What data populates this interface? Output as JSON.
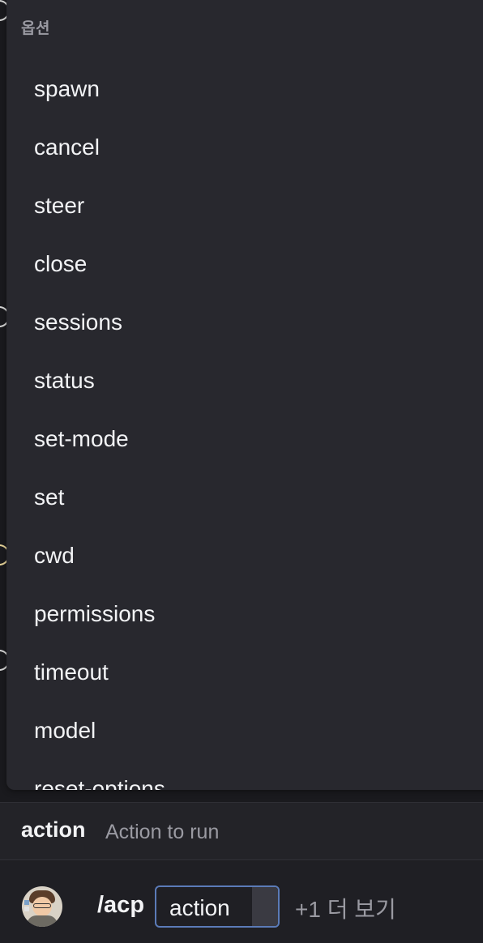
{
  "options": {
    "header": "옵션",
    "items": [
      {
        "label": "spawn"
      },
      {
        "label": "cancel"
      },
      {
        "label": "steer"
      },
      {
        "label": "close"
      },
      {
        "label": "sessions"
      },
      {
        "label": "status"
      },
      {
        "label": "set-mode"
      },
      {
        "label": "set"
      },
      {
        "label": "cwd"
      },
      {
        "label": "permissions"
      },
      {
        "label": "timeout"
      },
      {
        "label": "model"
      },
      {
        "label": "reset-options"
      }
    ]
  },
  "param_hint": {
    "name": "action",
    "description": "Action to run"
  },
  "composer": {
    "command": "/acp",
    "arg_label": "action",
    "more_label": "+1 더 보기"
  },
  "colors": {
    "background": "#1a1a1e",
    "panel": "#28282e",
    "text": "#f2f3f5",
    "muted": "#9a9aa2",
    "chip_border": "#5b7bb8"
  }
}
